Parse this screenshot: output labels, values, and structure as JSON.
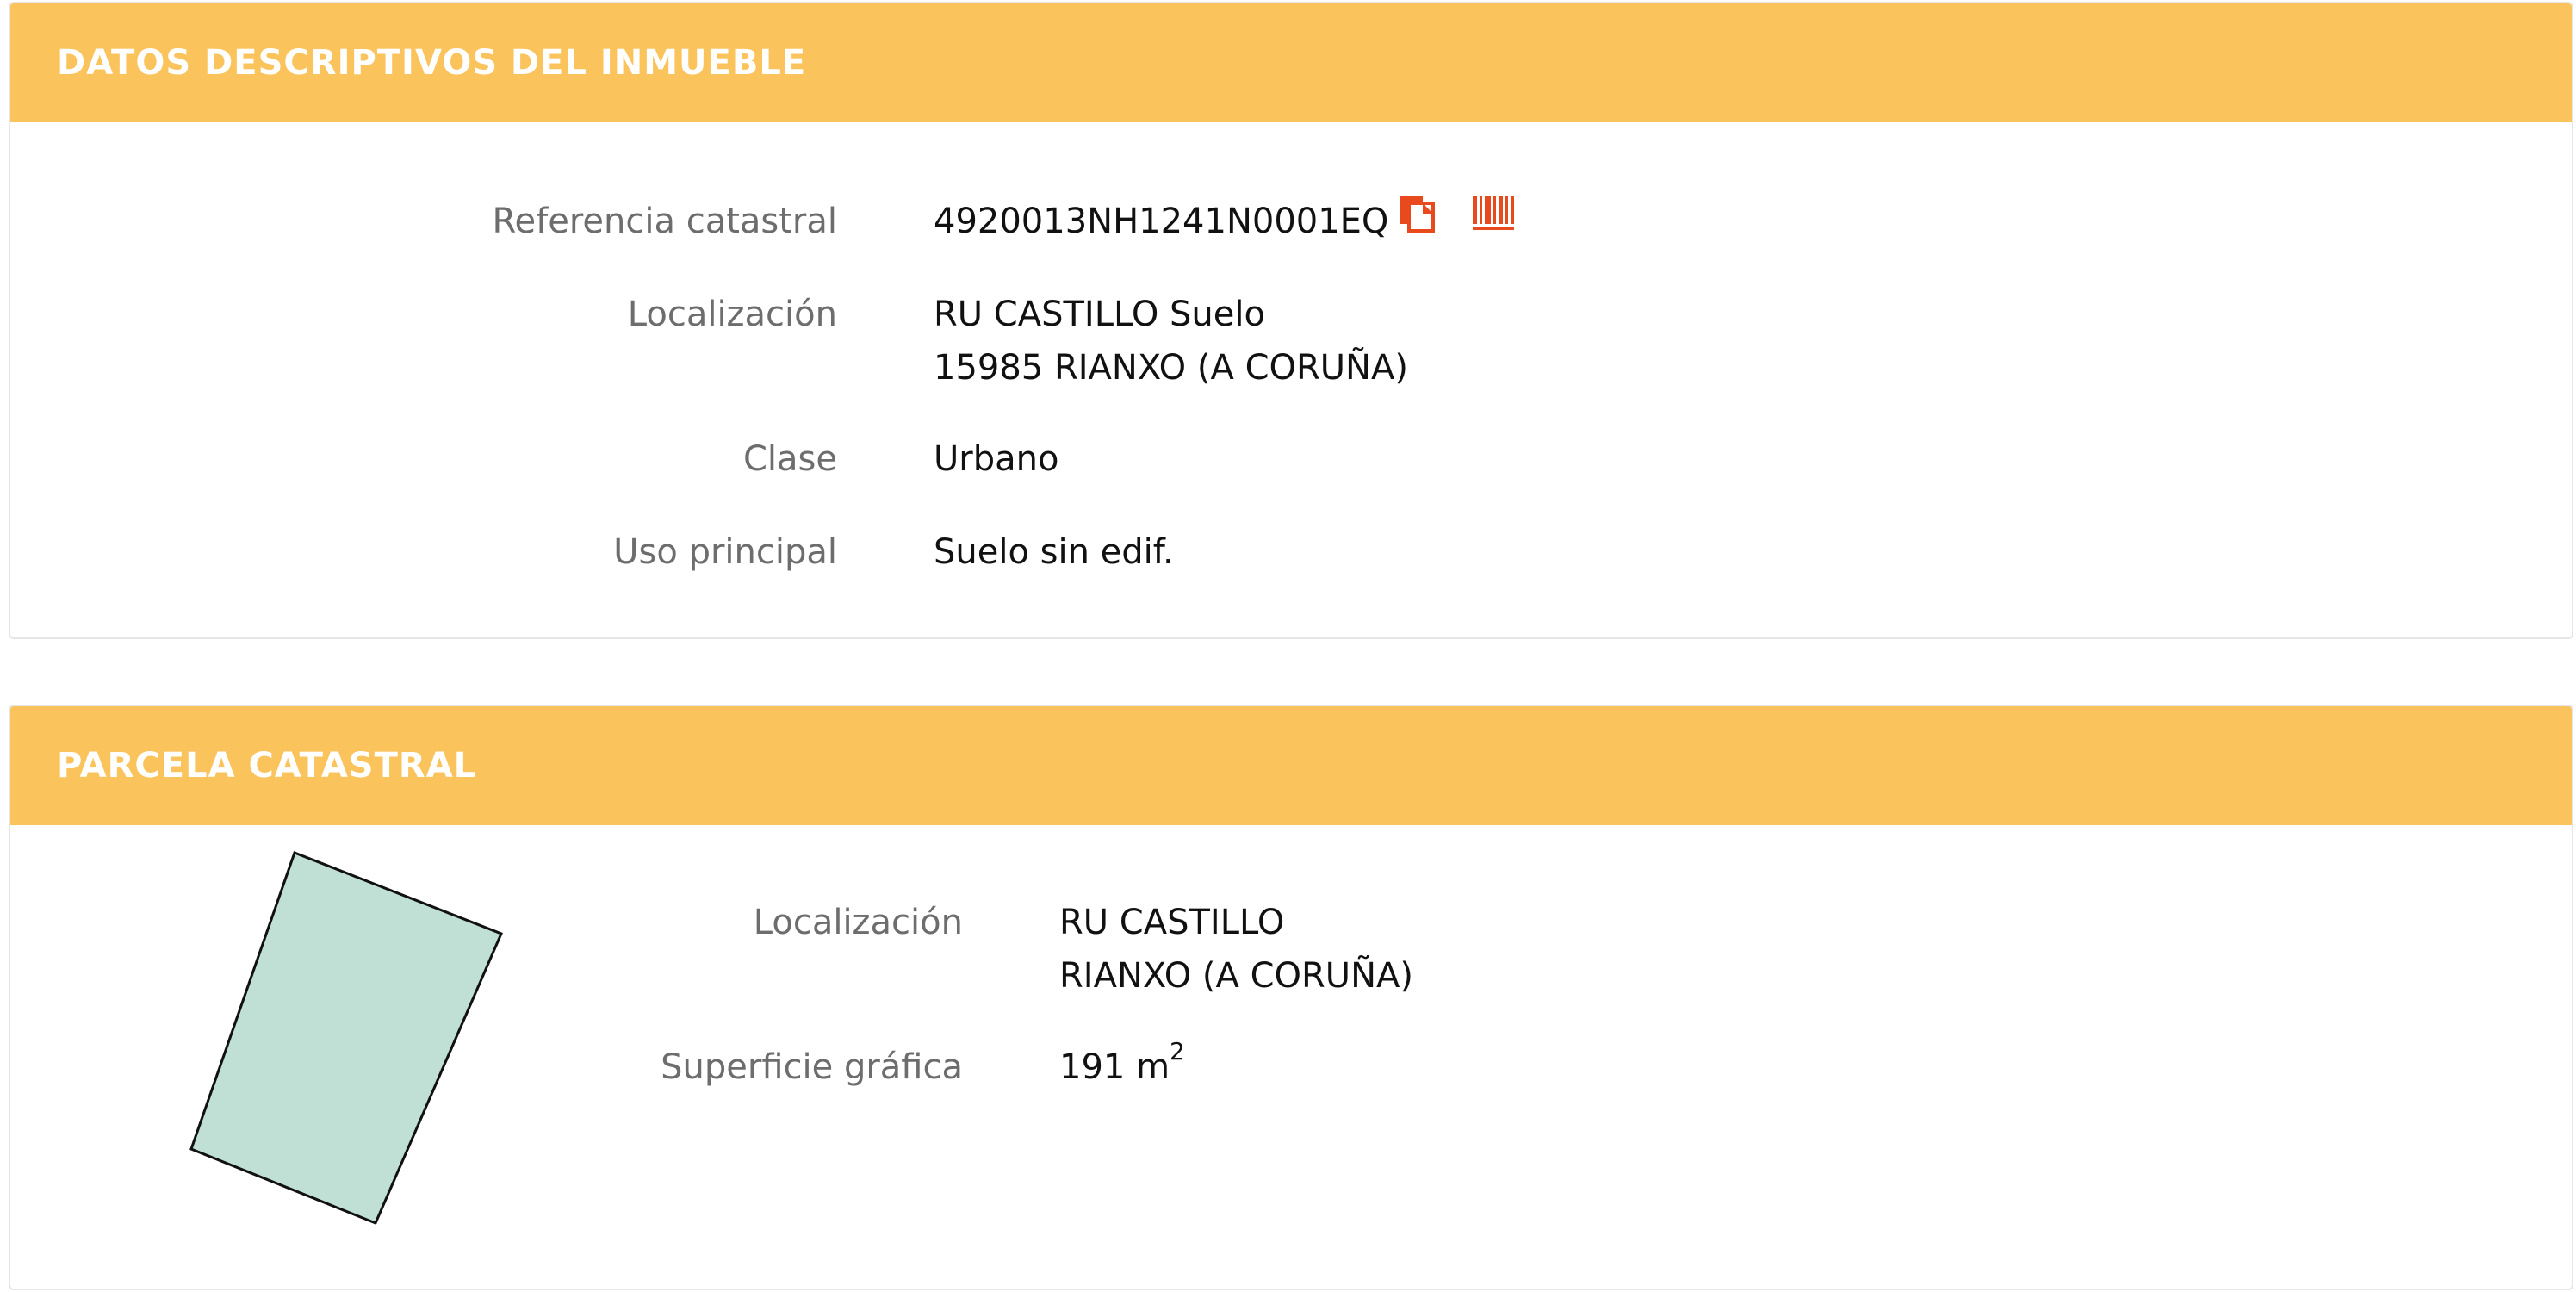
{
  "colors": {
    "header_bg": "#fbc35c",
    "header_text": "#ffffff",
    "label_text": "#6d6d6d",
    "value_text": "#111111",
    "icon_accent": "#e8491d",
    "parcel_fill": "#c0e0d6"
  },
  "inmueble": {
    "title": "DATOS DESCRIPTIVOS DEL INMUEBLE",
    "referencia": {
      "label": "Referencia catastral",
      "value": "4920013NH1241N0001EQ",
      "copy_icon": "copy-icon",
      "barcode_icon": "barcode-icon"
    },
    "localizacion": {
      "label": "Localización",
      "line1": "RU CASTILLO Suelo",
      "line2": "15985 RIANXO (A CORUÑA)"
    },
    "clase": {
      "label": "Clase",
      "value": "Urbano"
    },
    "uso": {
      "label": "Uso principal",
      "value": "Suelo sin edif."
    }
  },
  "parcela": {
    "title": "PARCELA CATASTRAL",
    "localizacion": {
      "label": "Localización",
      "line1": "RU CASTILLO",
      "line2": "RIANXO (A CORUÑA)"
    },
    "superficie": {
      "label": "Superficie gráfica",
      "value": "191 m",
      "unit_exponent": "2"
    }
  }
}
